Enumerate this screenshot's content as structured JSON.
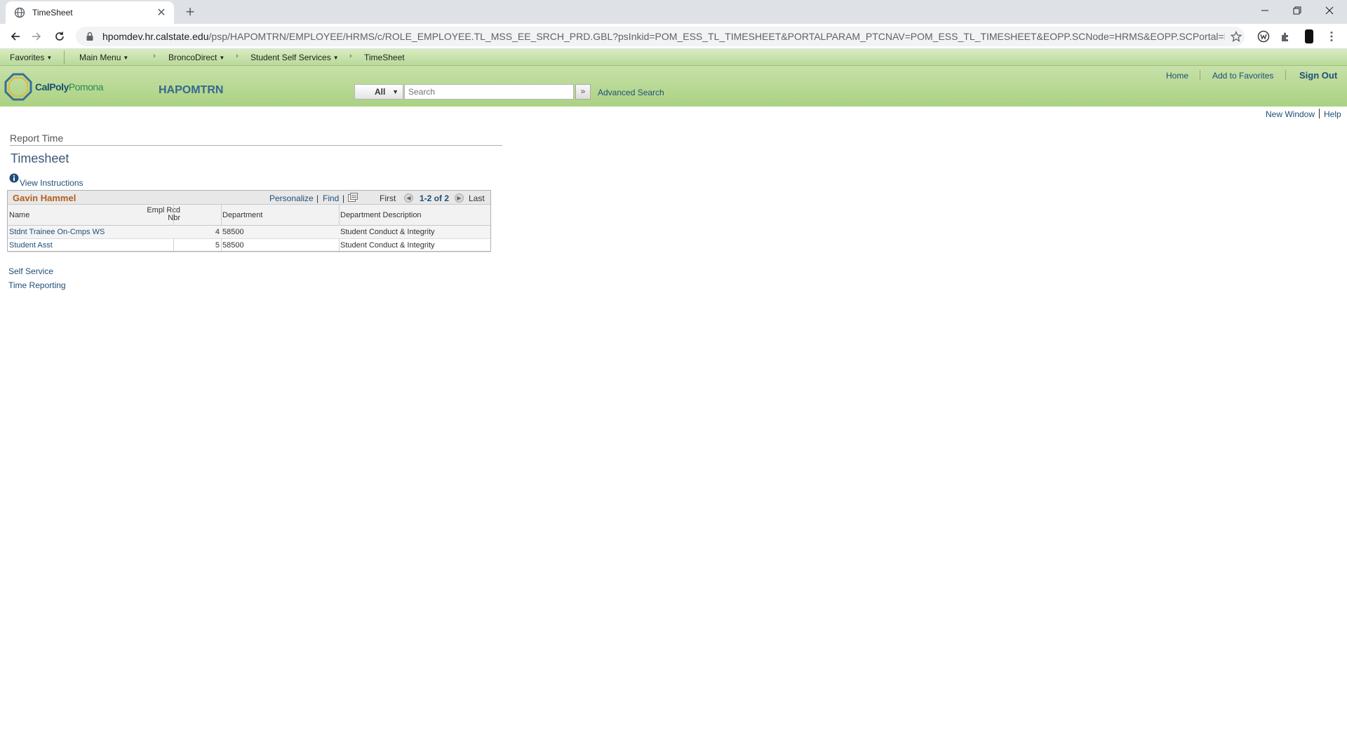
{
  "browser": {
    "tab_title": "TimeSheet",
    "url_host": "hpomdev.hr.calstate.edu",
    "url_path": "/psp/HAPOMTRN/EMPLOYEE/HRMS/c/ROLE_EMPLOYEE.TL_MSS_EE_SRCH_PRD.GBL?psInkid=POM_ESS_TL_TIMESHEET&PORTALPARAM_PTCNAV=POM_ESS_TL_TIMESHEET&EOPP.SCNode=HRMS&EOPP.SCPortal=EMPLOYEE&EOPP.S..."
  },
  "ps_nav": {
    "favorites": "Favorites",
    "main_menu": "Main Menu",
    "sep": "›",
    "crumb1": "BroncoDirect",
    "crumb2": "Student Self Services",
    "crumb3": "TimeSheet"
  },
  "banner": {
    "logo_part1": "CalPoly",
    "logo_part2": "Pomona",
    "db_name": "HAPOMTRN",
    "search_scope": "All",
    "search_placeholder": "Search",
    "go_symbol": "»",
    "advanced_search": "Advanced Search",
    "home": "Home",
    "add_favorites": "Add to Favorites",
    "sign_out": "Sign Out"
  },
  "util": {
    "new_window": "New Window",
    "help": "Help"
  },
  "page": {
    "breadcrumb_title": "Report Time",
    "title": "Timesheet",
    "view_instructions": "View Instructions"
  },
  "grid": {
    "owner": "Gavin Hammel",
    "personalize": "Personalize",
    "bar": "|",
    "find": "Find",
    "first": "First",
    "count": "1-2 of 2",
    "last": "Last",
    "headers": {
      "name": "Name",
      "empl_rcd_line1": "Empl Rcd",
      "empl_rcd_line2": "Nbr",
      "department": "Department",
      "dept_desc": "Department Description"
    },
    "rows": [
      {
        "name": "Stdnt Trainee On-Cmps WS",
        "empl_rcd": "4",
        "department": "58500",
        "dept_desc": "Student Conduct & Integrity"
      },
      {
        "name": "Student Asst",
        "empl_rcd": "5",
        "department": "58500",
        "dept_desc": "Student Conduct & Integrity"
      }
    ]
  },
  "links": {
    "self_service": "Self Service",
    "time_reporting": "Time Reporting"
  }
}
